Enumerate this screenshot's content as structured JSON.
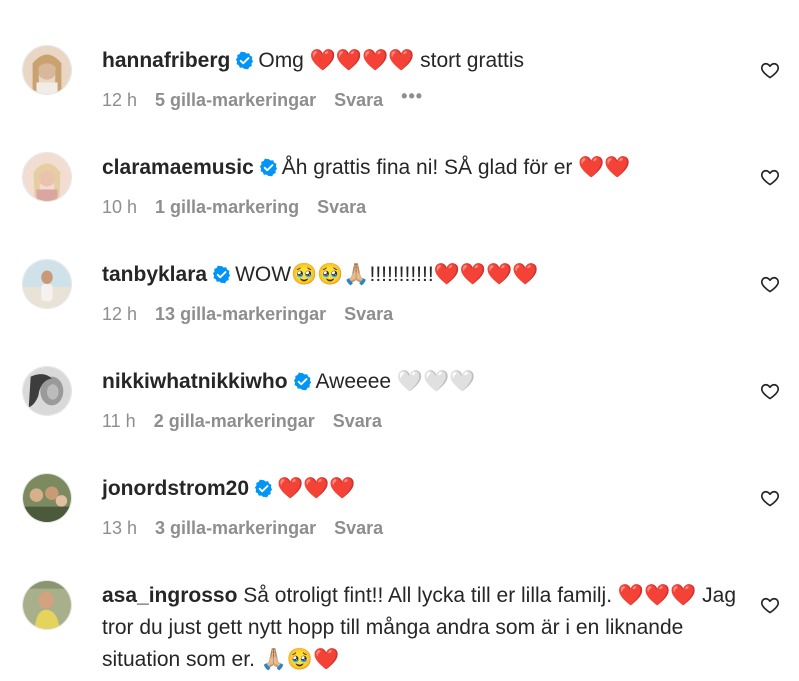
{
  "top_cut_text": "liked · stretched text partially cut off at the top",
  "comments": [
    {
      "username": "hannafriberg",
      "text": "Omg ❤️❤️❤️❤️ stort grattis",
      "time": "12 h",
      "likes": "5 gilla-markeringar",
      "reply": "Svara",
      "more": "•••"
    },
    {
      "username": "claramaemusic",
      "text": "Åh grattis fina ni! SÅ glad för er ❤️❤️",
      "time": "10 h",
      "likes": "1 gilla-markering",
      "reply": "Svara"
    },
    {
      "username": "tanbyklara",
      "text": "WOW🥹🥹🙏🏼!!!!!!!!!!!❤️❤️❤️❤️",
      "time": "12 h",
      "likes": "13 gilla-markeringar",
      "reply": "Svara"
    },
    {
      "username": "nikkiwhatnikkiwho",
      "text": "Aweeee 🤍🤍🤍",
      "time": "11 h",
      "likes": "2 gilla-markeringar",
      "reply": "Svara"
    },
    {
      "username": "jonordstrom20",
      "text": "❤️❤️❤️",
      "time": "13 h",
      "likes": "3 gilla-markeringar",
      "reply": "Svara"
    },
    {
      "username": "asa_ingrosso",
      "text": "Så otroligt fint!! All lycka till er lilla familj. ❤️❤️❤️ Jag tror du just gett nytt hopp till många andra som är i en liknande situation som er. 🙏🏼🥹❤️",
      "verified": false
    }
  ],
  "colors": {
    "text": "#262626",
    "meta": "#8e8e8e",
    "verified": "#0095f6"
  },
  "icons": {
    "verified": "verified-badge-icon",
    "like": "heart-outline-icon"
  }
}
